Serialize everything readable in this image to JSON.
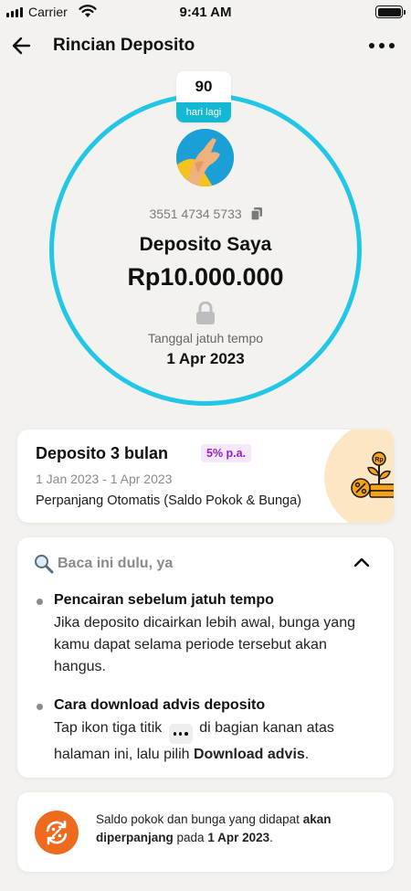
{
  "status_bar": {
    "carrier": "Carrier",
    "time": "9:41 AM"
  },
  "header": {
    "title": "Rincian Deposito"
  },
  "deposit": {
    "days_left": "90",
    "days_label": "hari lagi",
    "account_number": "3551 4734 5733",
    "name": "Deposito Saya",
    "amount": "Rp10.000.000",
    "due_label": "Tanggal jatuh tempo",
    "due_date": "1 Apr 2023"
  },
  "product": {
    "title": "Deposito 3 bulan",
    "rate": "5% p.a.",
    "period": "1 Jan 2023 - 1 Apr 2023",
    "renewal": "Perpanjang Otomatis (Saldo Pokok & Bunga)"
  },
  "info": {
    "title": "Baca ini dulu, ya",
    "items": [
      {
        "title": "Pencairan sebelum jatuh tempo",
        "body": "Jika deposito dicairkan lebih awal, bunga yang kamu dapat selama periode tersebut akan hangus."
      },
      {
        "title": "Cara download advis deposito",
        "body_prefix": "Tap ikon tiga titik",
        "body_middle": "di bagian kanan atas halaman ini, lalu pilih",
        "body_bold": "Download advis",
        "body_suffix": "."
      }
    ]
  },
  "footer_note": {
    "part1": "Saldo pokok dan bunga yang didapat",
    "part2_bold": "akan diperpanjang",
    "part3": "pada",
    "part4_bold": "1 Apr 2023",
    "part5": "."
  },
  "colors": {
    "ring": "#22c6e6",
    "badge": "#15b8d3",
    "rate_text": "#9a1ec4",
    "accent_orange": "#ee6a1e"
  },
  "icons": [
    "signal-icon",
    "wifi-icon",
    "battery-icon",
    "back-arrow-icon",
    "more-options-icon",
    "copy-icon",
    "lock-icon",
    "deposit-growth-icon",
    "magnifier-icon",
    "chevron-up-icon",
    "auto-renew-icon"
  ]
}
